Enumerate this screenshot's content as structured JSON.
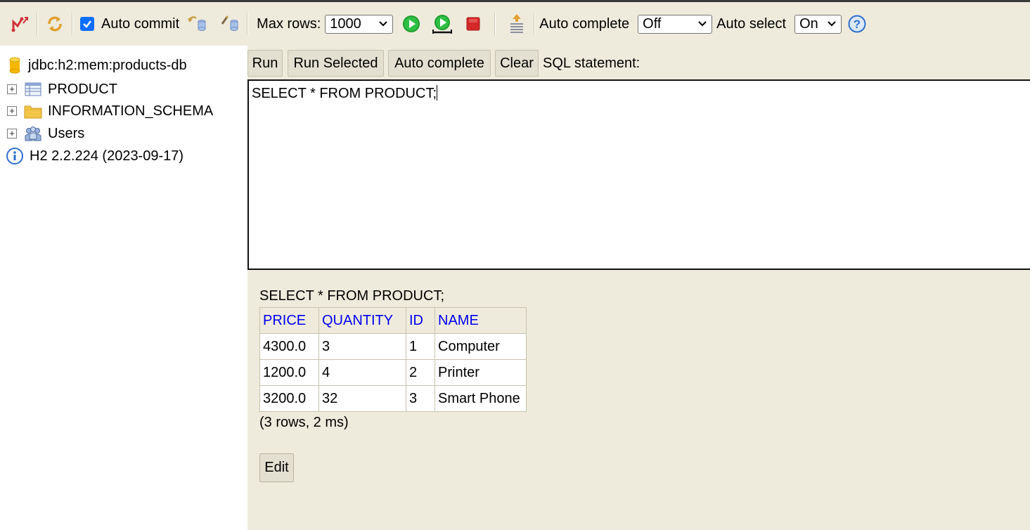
{
  "toolbar": {
    "disconnect_icon": "disconnect-icon",
    "refresh_icon": "refresh-icon",
    "auto_commit_label": "Auto commit",
    "auto_commit_checked": true,
    "rollback_icon": "rollback-icon",
    "commit_icon": "commit-icon",
    "max_rows_label": "Max rows:",
    "max_rows_value": "1000",
    "run_icon": "run-icon",
    "run_selected_icon": "run-selected-icon",
    "stop_icon": "stop-icon",
    "history_icon": "history-icon",
    "auto_complete_label": "Auto complete",
    "auto_complete_value": "Off",
    "auto_select_label": "Auto select",
    "auto_select_value": "On",
    "help_icon": "help-icon"
  },
  "tree": {
    "connection": "jdbc:h2:mem:products-db",
    "items": [
      {
        "label": "PRODUCT",
        "icon": "table-icon"
      },
      {
        "label": "INFORMATION_SCHEMA",
        "icon": "folder-icon"
      },
      {
        "label": "Users",
        "icon": "users-icon"
      }
    ],
    "version": "H2 2.2.224 (2023-09-17)"
  },
  "query": {
    "run_label": "Run",
    "run_selected_label": "Run Selected",
    "auto_complete_label": "Auto complete",
    "clear_label": "Clear",
    "sql_label": "SQL statement:",
    "sql_text": "SELECT * FROM PRODUCT;"
  },
  "results": {
    "statement": "SELECT * FROM PRODUCT;",
    "columns": [
      "PRICE",
      "QUANTITY",
      "ID",
      "NAME"
    ],
    "rows": [
      [
        "4300.0",
        "3",
        "1",
        "Computer"
      ],
      [
        "1200.0",
        "4",
        "2",
        "Printer"
      ],
      [
        "3200.0",
        "32",
        "3",
        "Smart Phone"
      ]
    ],
    "info": "(3 rows, 2 ms)",
    "edit_label": "Edit"
  },
  "colors": {
    "panel_bg": "#efebdc",
    "header_link": "#0000ee",
    "run_green": "#1e9e2e",
    "stop_red": "#d62828"
  }
}
